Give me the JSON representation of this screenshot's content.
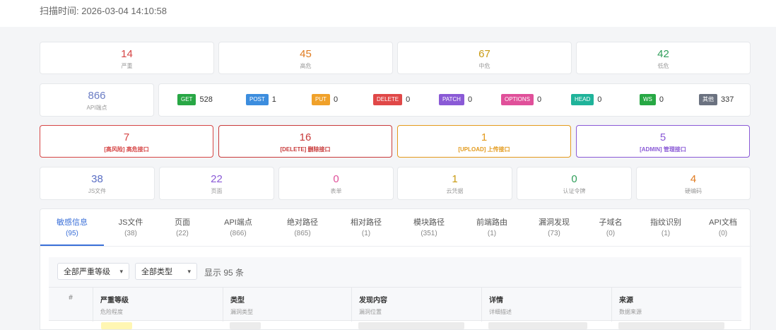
{
  "header": {
    "scan_time": "扫描时间: 2026-03-04 14:10:58"
  },
  "severity": [
    {
      "value": "14",
      "label": "严重",
      "color": "#d64545"
    },
    {
      "value": "45",
      "label": "高危",
      "color": "#e07b20"
    },
    {
      "value": "67",
      "label": "中危",
      "color": "#c99a12"
    },
    {
      "value": "42",
      "label": "低危",
      "color": "#2f9e5a"
    }
  ],
  "api_total": {
    "value": "866",
    "label": "API端点",
    "color": "#6a7cc4"
  },
  "methods": [
    {
      "name": "GET",
      "count": "528",
      "color": "#28a745"
    },
    {
      "name": "POST",
      "count": "1",
      "color": "#3c8dde"
    },
    {
      "name": "PUT",
      "count": "0",
      "color": "#f0a12a"
    },
    {
      "name": "DELETE",
      "count": "0",
      "color": "#e04848"
    },
    {
      "name": "PATCH",
      "count": "0",
      "color": "#8a5ad6"
    },
    {
      "name": "OPTIONS",
      "count": "0",
      "color": "#e0509a"
    },
    {
      "name": "HEAD",
      "count": "0",
      "color": "#1fb39a"
    },
    {
      "name": "WS",
      "count": "0",
      "color": "#27a844"
    },
    {
      "name": "其他",
      "count": "337",
      "color": "#6b7280"
    }
  ],
  "risks": [
    {
      "value": "7",
      "label": "[高风险] 高危接口",
      "color": "#d64545"
    },
    {
      "value": "16",
      "label": "[DELETE] 删除接口",
      "color": "#c83a3a"
    },
    {
      "value": "1",
      "label": "[UPLOAD] 上传接口",
      "color": "#e39a1c"
    },
    {
      "value": "5",
      "label": "[ADMIN] 管理接口",
      "color": "#8a5ad6"
    }
  ],
  "resources": [
    {
      "value": "38",
      "label": "JS文件",
      "color": "#5a6ec4"
    },
    {
      "value": "22",
      "label": "页面",
      "color": "#8a5ad6"
    },
    {
      "value": "0",
      "label": "表单",
      "color": "#e0509a"
    },
    {
      "value": "1",
      "label": "云凭据",
      "color": "#c99a12"
    },
    {
      "value": "0",
      "label": "认证令牌",
      "color": "#2f9e5a"
    },
    {
      "value": "4",
      "label": "硬编码",
      "color": "#e07b20"
    }
  ],
  "tabs": [
    {
      "label": "敏感信息",
      "count": "(95)"
    },
    {
      "label": "JS文件",
      "count": "(38)"
    },
    {
      "label": "页面",
      "count": "(22)"
    },
    {
      "label": "API端点",
      "count": "(866)"
    },
    {
      "label": "绝对路径",
      "count": "(865)"
    },
    {
      "label": "相对路径",
      "count": "(1)"
    },
    {
      "label": "模块路径",
      "count": "(351)"
    },
    {
      "label": "前端路由",
      "count": "(1)"
    },
    {
      "label": "漏洞发现",
      "count": "(73)"
    },
    {
      "label": "子域名",
      "count": "(0)"
    },
    {
      "label": "指纹识别",
      "count": "(1)"
    },
    {
      "label": "API文档",
      "count": "(0)"
    }
  ],
  "filters": {
    "severity_select": "全部严重等级",
    "type_select": "全部类型",
    "count_text": "显示 95 条"
  },
  "table": {
    "columns": [
      {
        "title": "#",
        "sub": ""
      },
      {
        "title": "严重等级",
        "sub": "危险程度"
      },
      {
        "title": "类型",
        "sub": "漏洞类型"
      },
      {
        "title": "发现内容",
        "sub": "漏洞位置"
      },
      {
        "title": "详情",
        "sub": "详细描述"
      },
      {
        "title": "来源",
        "sub": "数据来源"
      }
    ]
  }
}
